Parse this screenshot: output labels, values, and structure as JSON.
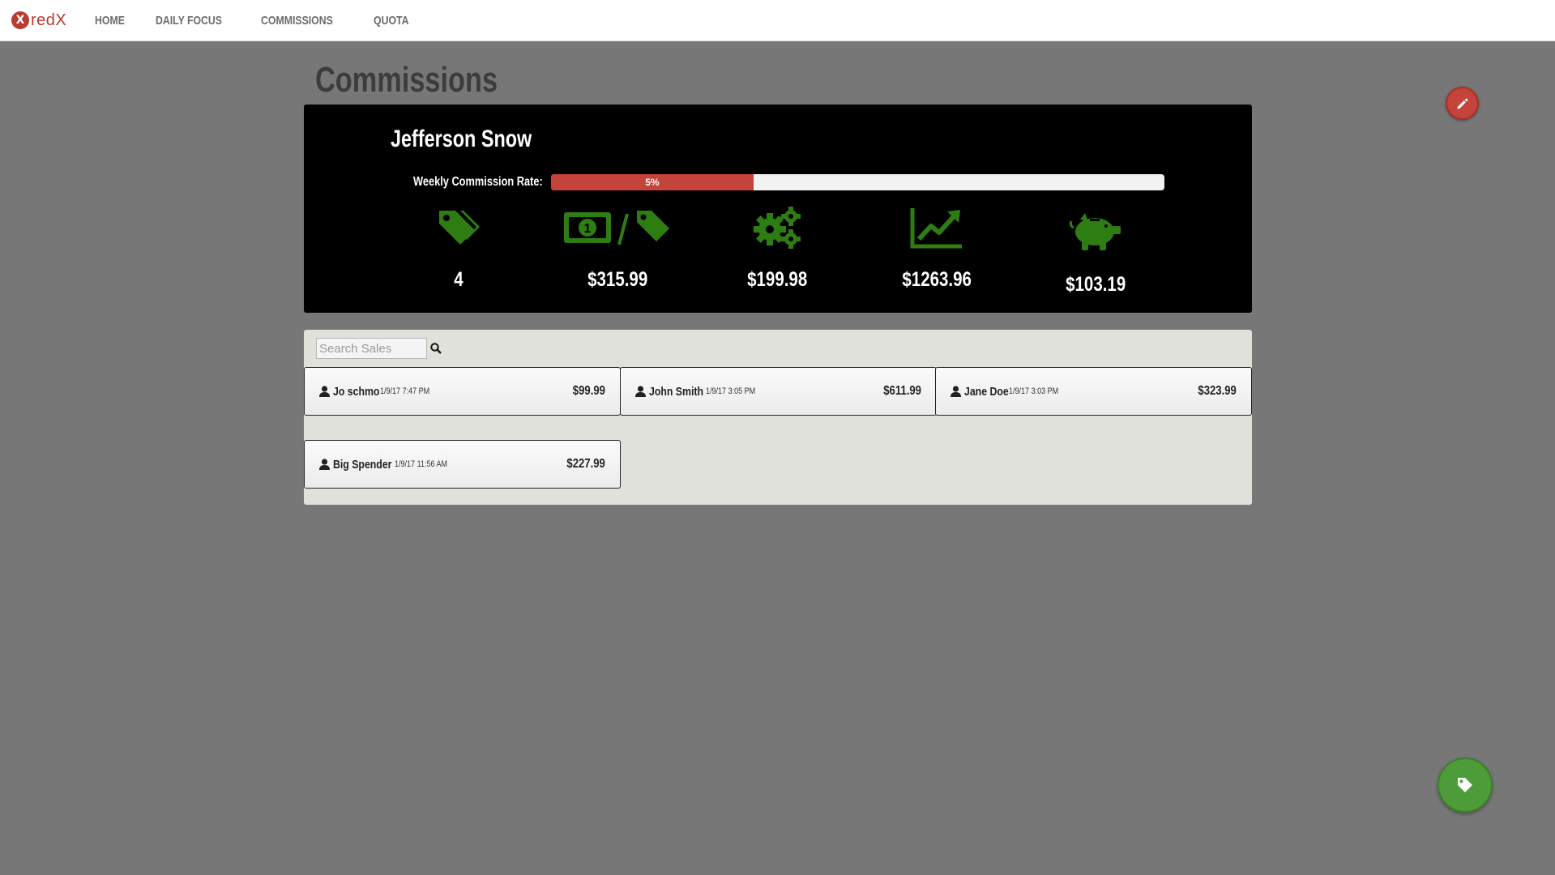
{
  "nav": {
    "brand": "redX",
    "brand_mark": "X",
    "links": [
      "HOME",
      "DAILY FOCUS",
      "COMMISSIONS",
      "QUOTA"
    ]
  },
  "page": {
    "title": "Commissions"
  },
  "summary": {
    "rep_name": "Jefferson Snow",
    "rate_label": "Weekly Commission Rate:",
    "rate_text": "5%",
    "rate_fill_fraction": 0.33,
    "icon_color": "#2e7d12",
    "stats": [
      {
        "icon": "tags-icon",
        "value": "4"
      },
      {
        "icon": "money-per-tag-icon",
        "value": "$315.99"
      },
      {
        "icon": "gears-icon",
        "value": "$199.98"
      },
      {
        "icon": "line-chart-icon",
        "value": "$1263.96"
      },
      {
        "icon": "piggy-bank-icon",
        "value": "$103.19"
      }
    ]
  },
  "sales": {
    "search_placeholder": "Search Sales",
    "items": [
      {
        "name": "Jo schmo",
        "date": "1/9/17 7:47 PM",
        "amount": "$99.99"
      },
      {
        "name": "John Smith",
        "date": "1/9/17 3:05 PM",
        "amount": "$611.99"
      },
      {
        "name": "Jane Doe",
        "date": "1/9/17 3:03 PM",
        "amount": "$323.99"
      },
      {
        "name": "Big Spender",
        "date": "1/9/17 11:56 AM",
        "amount": "$227.99"
      }
    ]
  },
  "colors": {
    "accent_red": "#c4433a",
    "accent_green": "#4e9b3a",
    "background": "#777777"
  }
}
